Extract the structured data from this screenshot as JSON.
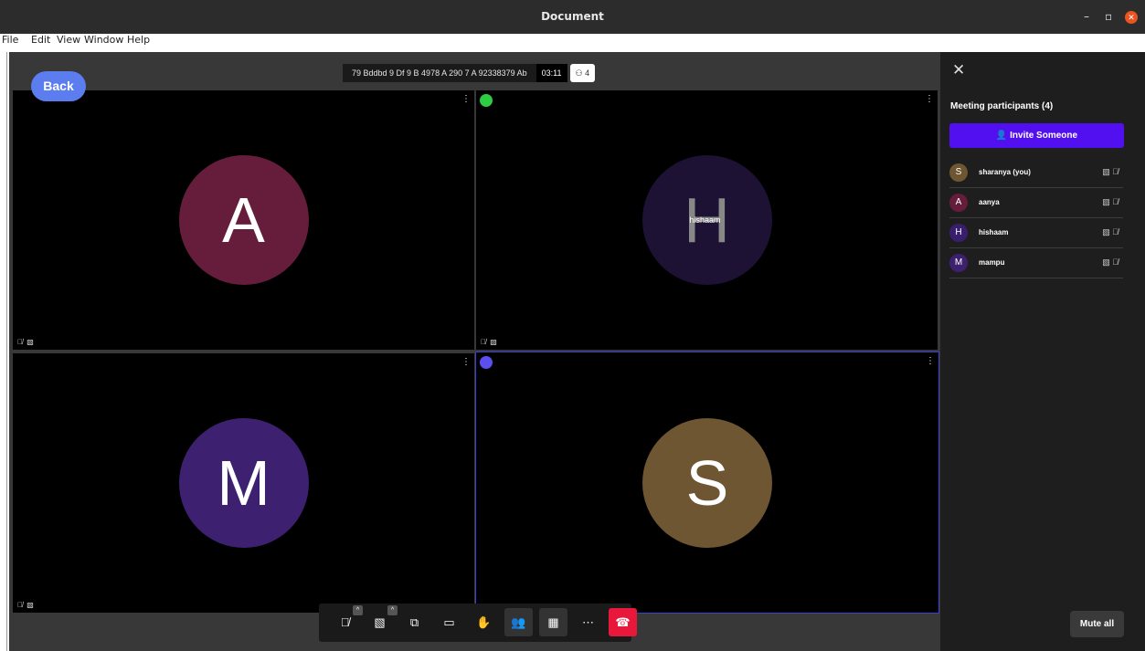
{
  "window": {
    "title": "Document",
    "minimize": "–",
    "restore": "▫",
    "close": "✕"
  },
  "menu": [
    "File",
    "Edit",
    "View",
    "Window",
    "Help"
  ],
  "meeting": {
    "title": "79 Bddbd 9 Df 9 B 4978 A 290 7 A 92338379 Ab",
    "time": "03:11",
    "participant_count_badge": "4"
  },
  "back_label": "Back",
  "tiles": [
    {
      "initial": "A",
      "color": "#661d3c",
      "more": "⋮",
      "status_icons": "🎙̸ ▧"
    },
    {
      "initial": "H",
      "color": "#1d1233",
      "more": "⋮",
      "status_icons": "🎙̸ ▧",
      "name_overlay": "hishaam",
      "badge_color": "#2ecc40"
    },
    {
      "initial": "M",
      "color": "#3d2170",
      "more": "⋮",
      "status_icons": "🎙̸ ▧"
    },
    {
      "initial": "S",
      "color": "#6e5632",
      "more": "⋮",
      "badge_color": "#5b4ff0"
    }
  ],
  "sidebar": {
    "close": "✕",
    "title": "Meeting participants (4)",
    "invite_label": "Invite Someone",
    "invite_icon": "👤",
    "participants": [
      {
        "initial": "S",
        "name": "sharanya (you)",
        "color": "#6e5632"
      },
      {
        "initial": "A",
        "name": "aanya",
        "color": "#661d3c"
      },
      {
        "initial": "H",
        "name": "hishaam",
        "color": "#3a1e6e"
      },
      {
        "initial": "M",
        "name": "mampu",
        "color": "#3d2170"
      }
    ],
    "row_icons": "▧ 🎙̸",
    "mute_all_label": "Mute all"
  },
  "toolbar": {
    "mic": "🎙̸",
    "camera": "▧",
    "share": "⧉",
    "chat": "▭",
    "hand": "✋",
    "participants": "👥",
    "layout": "▦",
    "more": "⋯",
    "end": "☎",
    "caret": "^",
    "end_color": "#e8173c"
  }
}
